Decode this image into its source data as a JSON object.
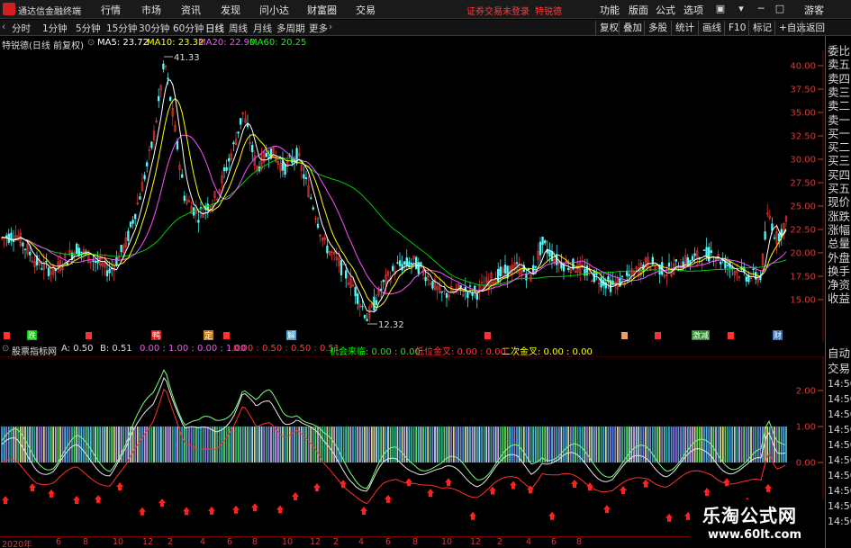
{
  "app": {
    "title": "通达信金融终端"
  },
  "menu": {
    "items": [
      "行情",
      "市场",
      "资讯",
      "发现",
      "问小达",
      "财富圈",
      "交易"
    ],
    "login_notice": "证券交易未登录",
    "stock_name": "特锐德",
    "right_items": [
      "功能",
      "版面",
      "公式",
      "选项"
    ],
    "guest": "游客"
  },
  "period_tabs": [
    "分时",
    "1分钟",
    "5分钟",
    "15分钟",
    "30分钟",
    "60分钟",
    "日线",
    "周线",
    "月线",
    "多周期",
    "更多"
  ],
  "toolbar_tabs": [
    "复权",
    "叠加",
    "多股",
    "统计",
    "画线",
    "F10",
    "标记",
    "+自选",
    "返回"
  ],
  "ma_bar": {
    "label": "特锐德(日线 前复权)",
    "ma5": "MA5: 23.72",
    "ma10": "MA10: 23.32",
    "ma20": "MA20: 22.90",
    "ma60": "MA60: 20.25"
  },
  "price_axis": [
    "40.00",
    "37.50",
    "35.00",
    "32.50",
    "30.00",
    "27.50",
    "25.00",
    "22.50",
    "20.00",
    "17.50",
    "15.00"
  ],
  "annotations": {
    "high": "41.33",
    "low": "12.32"
  },
  "event_markers": [
    "跌",
    "鸭",
    "定",
    "解",
    "激减",
    "财"
  ],
  "indicator_bar": {
    "name": "股票指标网",
    "a": "A: 0.50",
    "b": "B: 0.51",
    "seq1": "0.00 : 1.00 : 0.00 : 1.00",
    "seq2": "0.00 : 0.50 : 0.50 : 0.51",
    "signal1": "机会来临: 0.00 : 0.00",
    "signal2": "低位金叉: 0.00 : 0.00",
    "signal3": "二次金叉: 0.00 : 0.00"
  },
  "indicator_axis": [
    "2.00",
    "1.00",
    "0.00"
  ],
  "side_panel": {
    "top": [
      "委比",
      "卖五",
      "卖四",
      "卖三",
      "卖二",
      "卖一",
      "买一",
      "买二",
      "买三",
      "买四",
      "买五",
      "现价",
      "涨跌",
      "涨幅",
      "总量",
      "外盘",
      "换手",
      "净资",
      "收益"
    ],
    "bottom": [
      "自动",
      "交易",
      "14:50",
      "14:50",
      "14:50",
      "14:50",
      "14:50",
      "14:50",
      "14:50",
      "14:50",
      "14:50",
      "14:50"
    ]
  },
  "date_axis": [
    "2020年",
    "6",
    "8",
    "10",
    "12",
    "2",
    "4",
    "6",
    "8",
    "10",
    "12",
    "2",
    "4",
    "6",
    "8",
    "10",
    "12",
    "2",
    "4",
    "6",
    "8"
  ],
  "watermark": {
    "title": "乐淘公式网",
    "url": "www.60lt.com"
  },
  "colors": {
    "up": "#ff3c3c",
    "down": "#54ffff",
    "ma5": "#ffffff",
    "ma10": "#ffff00",
    "ma20": "#ff50ff",
    "ma60": "#00ff00",
    "axis_red": "#d63a3a"
  }
}
